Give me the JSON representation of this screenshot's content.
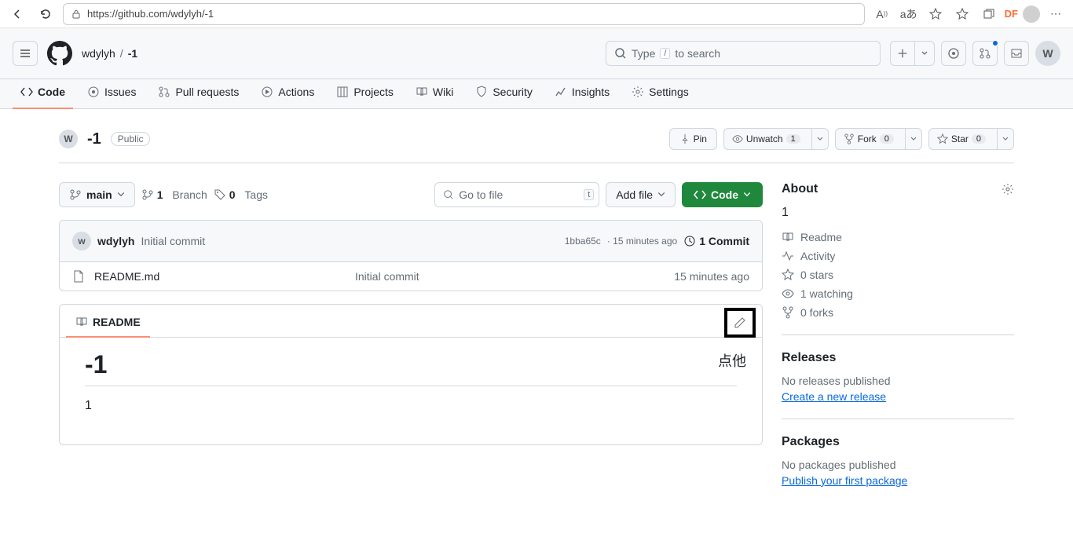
{
  "browser": {
    "url": "https://github.com/wdylyh/-1",
    "df": "DF"
  },
  "header": {
    "owner": "wdylyh",
    "repo": "-1",
    "search_prefix": "Type",
    "search_key": "/",
    "search_suffix": "to search",
    "avatar_letter": "W"
  },
  "tabs": {
    "code": "Code",
    "issues": "Issues",
    "pulls": "Pull requests",
    "actions": "Actions",
    "projects": "Projects",
    "wiki": "Wiki",
    "security": "Security",
    "insights": "Insights",
    "settings": "Settings"
  },
  "repo": {
    "avatar_letter": "W",
    "name": "-1",
    "visibility": "Public",
    "pin": "Pin",
    "unwatch": "Unwatch",
    "watch_count": "1",
    "fork": "Fork",
    "fork_count": "0",
    "star": "Star",
    "star_count": "0"
  },
  "files": {
    "branch": "main",
    "branches_num": "1",
    "branches_label": "Branch",
    "tags_num": "0",
    "tags_label": "Tags",
    "goto": "Go to file",
    "goto_key": "t",
    "addfile": "Add file",
    "code": "Code"
  },
  "commit": {
    "author": "wdylyh",
    "message": "Initial commit",
    "sha": "1bba65c",
    "time": "15 minutes ago",
    "count_label": "1 Commit"
  },
  "filelist": [
    {
      "name": "README.md",
      "msg": "Initial commit",
      "time": "15 minutes ago"
    }
  ],
  "readme": {
    "tab": "README",
    "annotation": "点他",
    "h1": "-1",
    "body": "1"
  },
  "about": {
    "title": "About",
    "desc": "1",
    "readme": "Readme",
    "activity": "Activity",
    "stars": "0 stars",
    "watching": "1 watching",
    "forks": "0 forks"
  },
  "releases": {
    "title": "Releases",
    "empty": "No releases published",
    "action": "Create a new release"
  },
  "packages": {
    "title": "Packages",
    "empty": "No packages published",
    "action": "Publish your first package"
  }
}
